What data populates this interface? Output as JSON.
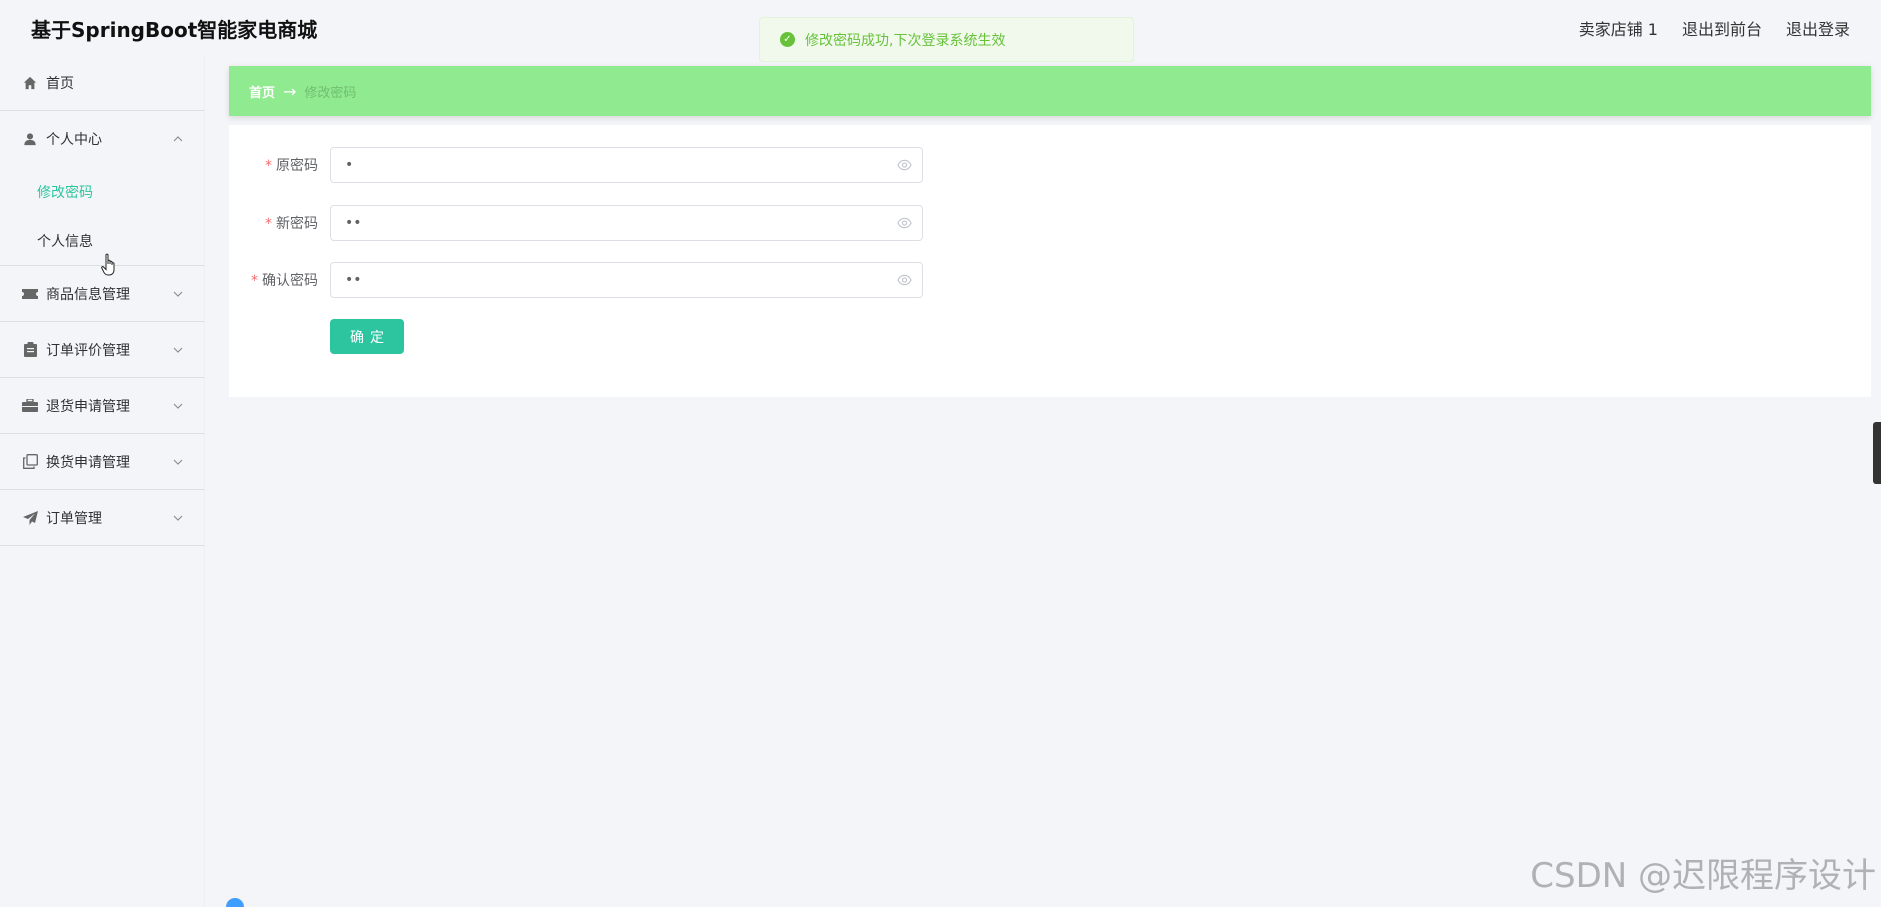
{
  "header": {
    "title": "基于SpringBoot智能家电商城",
    "links": [
      "卖家店铺 1",
      "退出到前台",
      "退出登录"
    ]
  },
  "toast": {
    "message": "修改密码成功,下次登录系统生效",
    "icon": "check-circle-icon",
    "color": "#67c23a"
  },
  "sidebar": {
    "home": {
      "label": "首页",
      "icon": "home-icon"
    },
    "personal_center": {
      "label": "个人中心",
      "icon": "user-icon",
      "expanded": true,
      "children": [
        {
          "label": "修改密码",
          "active": true
        },
        {
          "label": "个人信息",
          "active": false
        }
      ]
    },
    "items": [
      {
        "label": "商品信息管理",
        "icon": "ticket-icon"
      },
      {
        "label": "订单评价管理",
        "icon": "clipboard-icon"
      },
      {
        "label": "退货申请管理",
        "icon": "briefcase-icon"
      },
      {
        "label": "换货申请管理",
        "icon": "copy-icon"
      },
      {
        "label": "订单管理",
        "icon": "send-icon"
      }
    ]
  },
  "breadcrumb": {
    "home": "首页",
    "separator": "→",
    "current": "修改密码",
    "bg_color": "#90ea90"
  },
  "form": {
    "fields": [
      {
        "label": "原密码",
        "required": true,
        "value": "•"
      },
      {
        "label": "新密码",
        "required": true,
        "value": "••"
      },
      {
        "label": "确认密码",
        "required": true,
        "value": "••"
      }
    ],
    "submit_label": "确定",
    "accent_color": "#2dc5a0"
  },
  "watermark": "CSDN @迟限程序设计"
}
